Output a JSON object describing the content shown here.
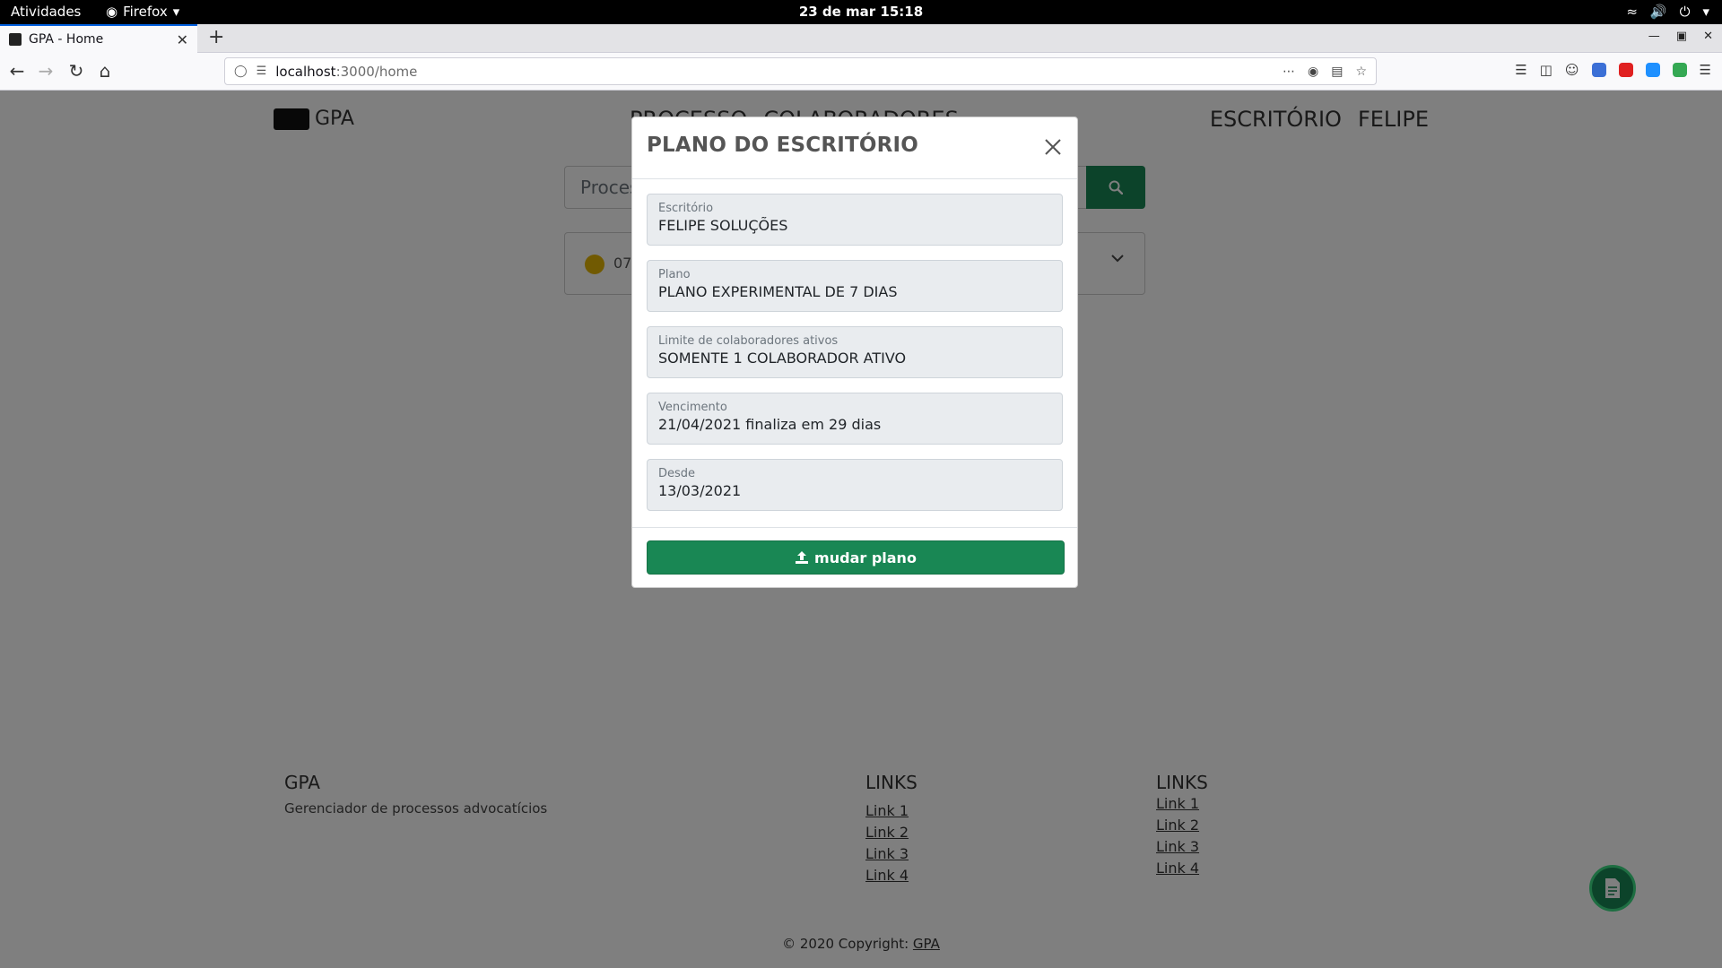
{
  "system": {
    "activities": "Atividades",
    "app_name": "Firefox",
    "clock": "23 de mar  15:18"
  },
  "browser": {
    "tab_title": "GPA - Home",
    "url_host": "localhost",
    "url_path": ":3000/home"
  },
  "page": {
    "brand": "GPA",
    "nav_center": [
      "PROCESSO",
      "COLABORADORES"
    ],
    "nav_right": [
      "ESCRITÓRIO",
      "FELIPE"
    ],
    "search_placeholder": "Proces",
    "card_number": "07"
  },
  "modal": {
    "title": "PLANO DO ESCRITÓRIO",
    "fields": [
      {
        "label": "Escritório",
        "value": "FELIPE SOLUÇÕES"
      },
      {
        "label": "Plano",
        "value": "PLANO EXPERIMENTAL DE 7 DIAS"
      },
      {
        "label": "Limite de colaboradores ativos",
        "value": "SOMENTE 1 COLABORADOR ATIVO"
      },
      {
        "label": "Vencimento",
        "value": "21/04/2021 finaliza em 29 dias"
      },
      {
        "label": "Desde",
        "value": "13/03/2021"
      }
    ],
    "button_label": "mudar plano"
  },
  "footer": {
    "col1_title": "GPA",
    "col1_text": "Gerenciador de processos advocatícios",
    "col2_title": "LINKS",
    "col2_links": [
      "Link 1",
      "Link 2",
      "Link 3",
      "Link 4"
    ],
    "col3_title": "LINKS",
    "col3_links": [
      "Link 1",
      "Link 2",
      "Link 3",
      "Link 4"
    ],
    "copyright_text": "© 2020 Copyright: ",
    "copyright_link": "GPA"
  },
  "colors": {
    "primary": "#198754",
    "status_dot": "#e3b505",
    "backdrop": "rgba(0,0,0,0.5)"
  }
}
